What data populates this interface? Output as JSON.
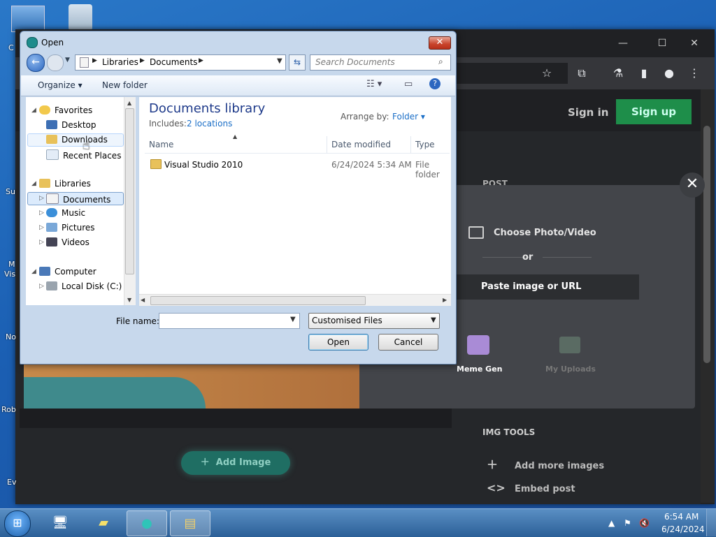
{
  "dialog": {
    "title": "Open",
    "breadcrumbs": [
      "Libraries",
      "Documents"
    ],
    "search_placeholder": "Search Documents",
    "toolbar": {
      "organize": "Organize",
      "new_folder": "New folder"
    },
    "nav_tree": {
      "favorites": "Favorites",
      "favorites_items": [
        "Desktop",
        "Downloads",
        "Recent Places"
      ],
      "libraries": "Libraries",
      "libraries_items": [
        "Documents",
        "Music",
        "Pictures",
        "Videos"
      ],
      "computer": "Computer",
      "computer_items": [
        "Local Disk (C:)"
      ]
    },
    "library_title": "Documents library",
    "includes_label": "Includes:",
    "includes_link": "2 locations",
    "arrange_label": "Arrange by:",
    "arrange_value": "Folder",
    "columns": [
      "Name",
      "Date modified",
      "Type"
    ],
    "files": [
      {
        "name": "Visual Studio 2010",
        "date": "6/24/2024 5:34 AM",
        "type": "File folder"
      }
    ],
    "file_name_label": "File name:",
    "file_name_value": "",
    "filter_value": "Customised Files",
    "open_button": "Open",
    "cancel_button": "Cancel"
  },
  "browser": {
    "signin": "Sign in",
    "signup": "Sign up",
    "post_label": "POST",
    "choose": "Choose Photo/Video",
    "or": "or",
    "paste": "Paste image or URL",
    "meme_gen": "Meme Gen",
    "my_uploads": "My Uploads",
    "img_tools": "IMG TOOLS",
    "add_more": "Add more images",
    "embed": "Embed post",
    "add_image": "Add Image"
  },
  "taskbar": {
    "time": "6:54 AM",
    "date": "6/24/2024"
  },
  "colors": {
    "signup_green": "#1e8e4a",
    "link_blue": "#1a6ec7",
    "title_blue": "#1e3a8a"
  }
}
